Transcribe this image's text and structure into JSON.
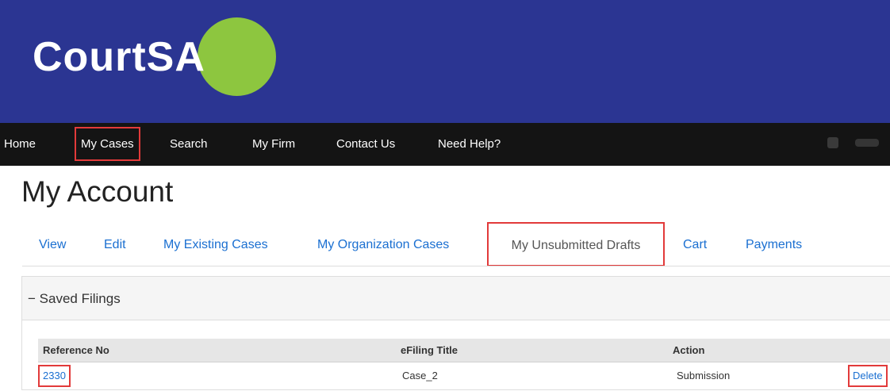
{
  "logo": {
    "text_court": "Court",
    "text_sa": "SA",
    "brand_color": "#2b3592",
    "accent_color": "#8dc63f"
  },
  "nav": {
    "items": [
      {
        "label": "Home"
      },
      {
        "label": "My Cases"
      },
      {
        "label": "Search"
      },
      {
        "label": "My Firm"
      },
      {
        "label": "Contact Us"
      },
      {
        "label": "Need Help?"
      }
    ]
  },
  "page": {
    "title": "My Account"
  },
  "tabs": [
    {
      "label": "View"
    },
    {
      "label": "Edit"
    },
    {
      "label": "My Existing Cases"
    },
    {
      "label": "My Organization Cases"
    },
    {
      "label": "My Unsubmitted Drafts"
    },
    {
      "label": "Cart"
    },
    {
      "label": "Payments"
    }
  ],
  "panel": {
    "title": "− Saved Filings",
    "columns": [
      "Reference No",
      "eFiling Title",
      "Action"
    ],
    "rows": [
      {
        "reference_no": "2330",
        "efiling_title": "Case_2",
        "action": "Submission",
        "delete_label": "Delete"
      }
    ]
  },
  "highlight_color": "#e23a3a"
}
